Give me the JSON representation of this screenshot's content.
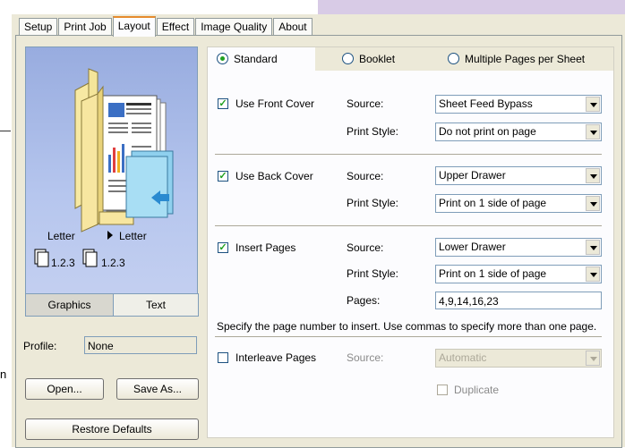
{
  "tabs": [
    "Setup",
    "Print Job",
    "Layout",
    "Effect",
    "Image Quality",
    "About"
  ],
  "active_tab": "Layout",
  "preview": {
    "paper_in": "Letter",
    "paper_out": "Letter",
    "order_in": "1.2.3",
    "order_out": "1.2.3",
    "view_buttons": [
      "Graphics",
      "Text"
    ]
  },
  "profile": {
    "label": "Profile:",
    "value": "None"
  },
  "buttons": {
    "open": "Open...",
    "save_as": "Save As...",
    "restore": "Restore Defaults"
  },
  "modes": [
    {
      "label": "Standard",
      "selected": true
    },
    {
      "label": "Booklet",
      "selected": false
    },
    {
      "label": "Multiple Pages per Sheet",
      "selected": false
    }
  ],
  "front_cover": {
    "label": "Use Front Cover",
    "checked": true,
    "source_label": "Source:",
    "source": "Sheet Feed Bypass",
    "style_label": "Print Style:",
    "style": "Do not print on page"
  },
  "back_cover": {
    "label": "Use Back Cover",
    "checked": true,
    "source_label": "Source:",
    "source": "Upper Drawer",
    "style_label": "Print Style:",
    "style": "Print on 1 side of page"
  },
  "insert_pages": {
    "label": "Insert Pages",
    "checked": true,
    "source_label": "Source:",
    "source": "Lower Drawer",
    "style_label": "Print Style:",
    "style": "Print on 1 side of page",
    "pages_label": "Pages:",
    "pages": "4,9,14,16,23",
    "hint": "Specify the page number to insert. Use commas to specify more than one page."
  },
  "interleave": {
    "label": "Interleave Pages",
    "checked": false,
    "source_label": "Source:",
    "source": "Automatic",
    "duplicate_label": "Duplicate"
  },
  "edge": {
    "letter": "n"
  },
  "colors": {
    "tab_highlight": "#e68b2c",
    "check": "#21a121",
    "dialog": "#ece9d8"
  }
}
